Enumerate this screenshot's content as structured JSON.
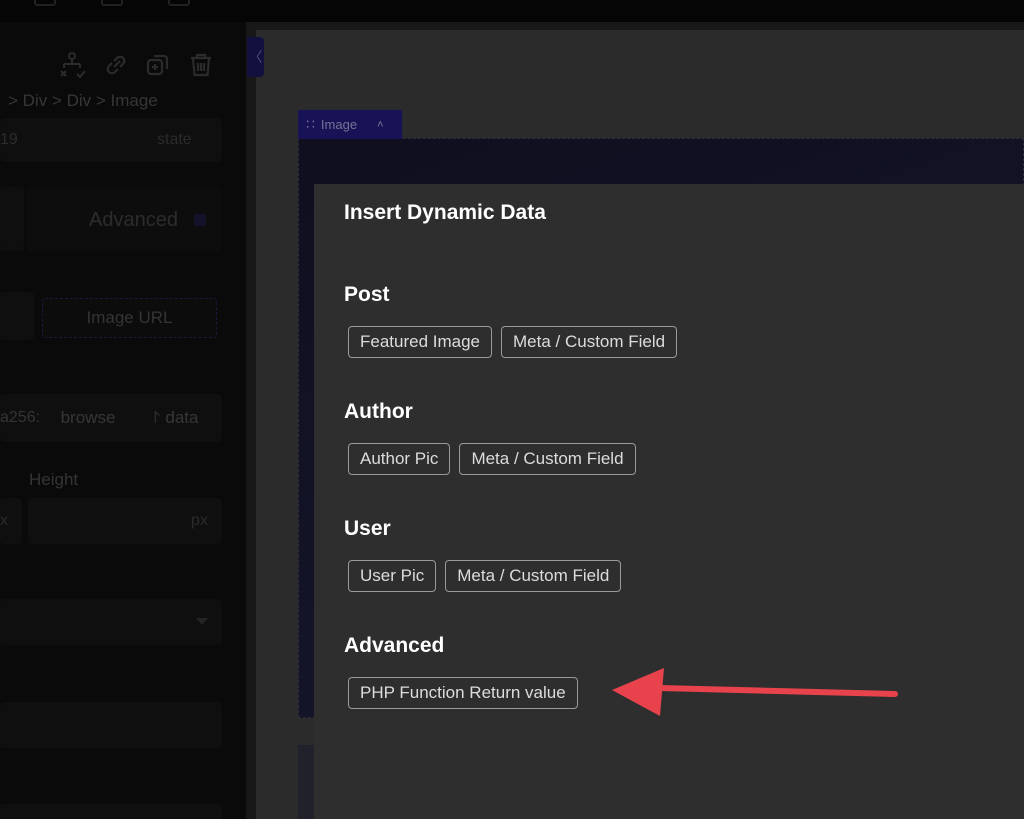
{
  "sidebar": {
    "breadcrumb": "> Div > Div > Image",
    "id_value": "19",
    "state_label": "state",
    "advanced_tab": "Advanced",
    "image_url_tab": "Image URL",
    "url_prefix": "a256:",
    "browse_button": "browse",
    "data_button": "data",
    "data_icon": "⨡",
    "height_label": "Height",
    "width_unit": "x",
    "height_unit": "px",
    "toolbar_icons": [
      "hierarchy-icon",
      "link-icon",
      "duplicate-icon",
      "trash-icon"
    ]
  },
  "canvas": {
    "collapse_glyph": "〈",
    "element_tag": "Image",
    "tag_grip": "∷",
    "tag_caret": "˄"
  },
  "modal": {
    "title": "Insert Dynamic Data",
    "sections": [
      {
        "title": "Post",
        "chips": [
          "Featured Image",
          "Meta / Custom Field"
        ]
      },
      {
        "title": "Author",
        "chips": [
          "Author Pic",
          "Meta / Custom Field"
        ]
      },
      {
        "title": "User",
        "chips": [
          "User Pic",
          "Meta / Custom Field"
        ]
      },
      {
        "title": "Advanced",
        "chips": [
          "PHP Function Return value"
        ]
      }
    ]
  },
  "colors": {
    "accent": "#2a1f96",
    "annotation_arrow": "#e8434c",
    "modal_bg": "#2e2e2e"
  }
}
